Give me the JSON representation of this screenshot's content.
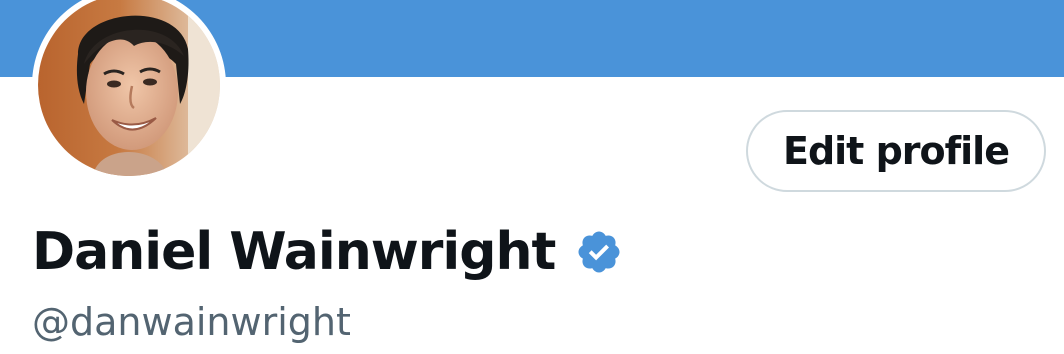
{
  "profile": {
    "display_name": "Daniel Wainwright",
    "handle": "@danwainwright",
    "verified": true,
    "edit_button_label": "Edit profile"
  },
  "colors": {
    "banner": "#4a93d9",
    "verified_badge": "#4a93d9",
    "text_primary": "#0f1419",
    "text_secondary": "#536471",
    "button_border": "#cfd9de"
  },
  "icons": {
    "avatar": "profile-photo",
    "verified": "verified-badge-icon"
  }
}
